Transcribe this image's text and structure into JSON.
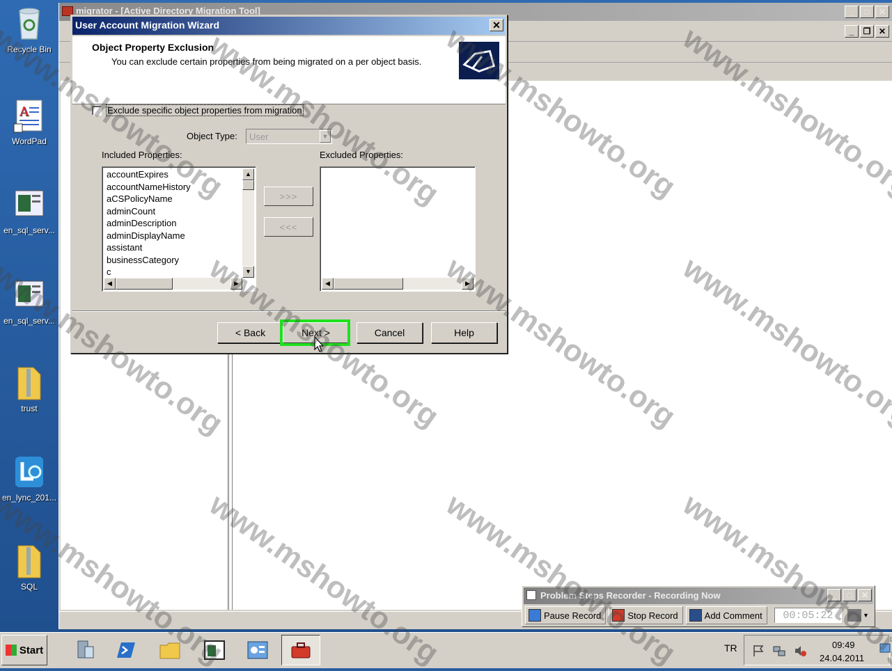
{
  "desktop": {
    "icons": [
      {
        "label": "Recycle Bin"
      },
      {
        "label": "WordPad"
      },
      {
        "label": "en_sql_serv..."
      },
      {
        "label": "en_sql_serv..."
      },
      {
        "label": "trust"
      },
      {
        "label": "en_lync_201..."
      },
      {
        "label": "SQL"
      }
    ]
  },
  "app": {
    "title": "migrator - [Active Directory Migration Tool]"
  },
  "wizard": {
    "title": "User Account Migration Wizard",
    "header_title": "Object Property Exclusion",
    "header_subtitle": "You can exclude certain properties from being migrated on a per object basis.",
    "exclude_checkbox_label": "Exclude specific object properties from migration",
    "exclude_checked": false,
    "object_type_label": "Object Type:",
    "object_type_value": "User",
    "included_label": "Included Properties:",
    "excluded_label": "Excluded Properties:",
    "included_items": [
      "accountExpires",
      "accountNameHistory",
      "aCSPolicyName",
      "adminCount",
      "adminDescription",
      "adminDisplayName",
      "assistant",
      "businessCategory",
      "c"
    ],
    "excluded_items": [],
    "add_button": ">>>",
    "remove_button": "<<<",
    "back_button": "< Back",
    "next_button": "Next >",
    "cancel_button": "Cancel",
    "help_button": "Help",
    "highlight_color": "#1ee01e"
  },
  "psr": {
    "title": "Problem Steps Recorder - Recording Now",
    "pause_label": "Pause Record",
    "stop_label": "Stop Record",
    "comment_label": "Add Comment",
    "elapsed": "00:05:22"
  },
  "taskbar": {
    "start_label": "Start",
    "language": "TR",
    "time": "09:49",
    "date": "24.04.2011"
  },
  "watermark": "www.mshowto.org"
}
